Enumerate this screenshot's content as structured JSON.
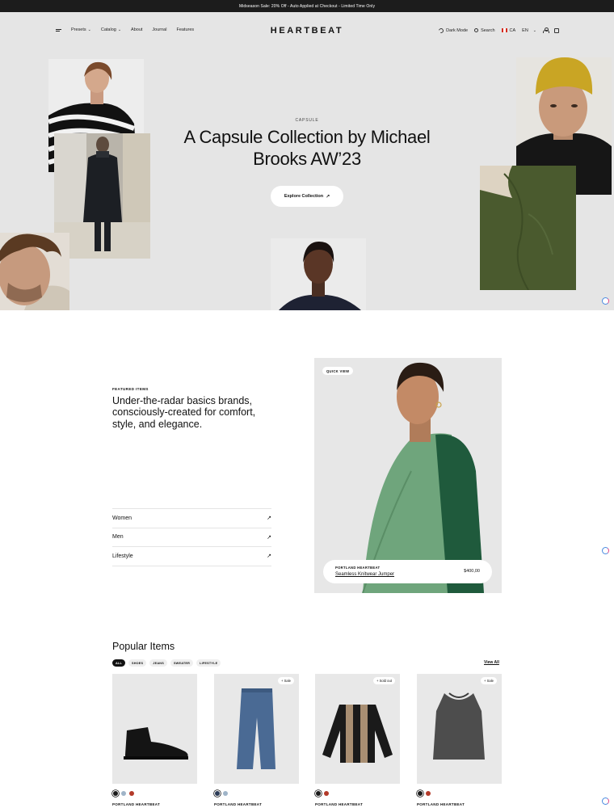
{
  "announcement": "Midseason Sale: 20% Off - Auto Applied at Checkout - Limited Time Only",
  "nav": {
    "menu_items": [
      "Presets",
      "Catalog",
      "About",
      "Journal",
      "Features"
    ],
    "logo": "HEARTBEAT",
    "dark_mode": "Dark Mode",
    "search": "Search",
    "country": "CA",
    "language": "EN"
  },
  "hero": {
    "eyebrow": "CAPSULE",
    "title": "A Capsule Collection by Michael Brooks AW’23",
    "cta": "Explore Collection",
    "cta_icon": "arrow-up-right-icon"
  },
  "featured": {
    "eyebrow": "FEATURED ITEMS",
    "title": "Under-the-radar basics brands, consciously-created for comfort, style, and elegance.",
    "categories": [
      {
        "label": "Women"
      },
      {
        "label": "Men"
      },
      {
        "label": "Lifestyle"
      }
    ],
    "quick_view": "QUICK VIEW",
    "card": {
      "brand": "PORTLAND HEARTBEAT",
      "name": "Seamless Knitwear Jumper",
      "price": "$400,00"
    }
  },
  "popular": {
    "title": "Popular Items",
    "filters": [
      "ALL",
      "SHOES",
      "JEANS",
      "SWEATER",
      "LIFESTYLE"
    ],
    "active_filter": "ALL",
    "view_all": "View All",
    "products": [
      {
        "brand": "PORTLAND HEARTBEAT",
        "badge": "",
        "swatches": [
          "#1a1a1a",
          "#9fb4c8",
          "#b33a2a"
        ]
      },
      {
        "brand": "PORTLAND HEARTBEAT",
        "badge": "+ Sale",
        "swatches": [
          "#2d3c57",
          "#9fb4c8"
        ]
      },
      {
        "brand": "PORTLAND HEARTBEAT",
        "badge": "+ Sold out",
        "swatches": [
          "#1a1a1a",
          "#b33a2a"
        ]
      },
      {
        "brand": "PORTLAND HEARTBEAT",
        "badge": "+ Sale",
        "swatches": [
          "#1a1a1a",
          "#b33a2a"
        ]
      }
    ]
  },
  "colors": {
    "hero_bg": "#e5e5e5",
    "announcement_bg": "#1c1c1c",
    "accent": "#111111"
  }
}
